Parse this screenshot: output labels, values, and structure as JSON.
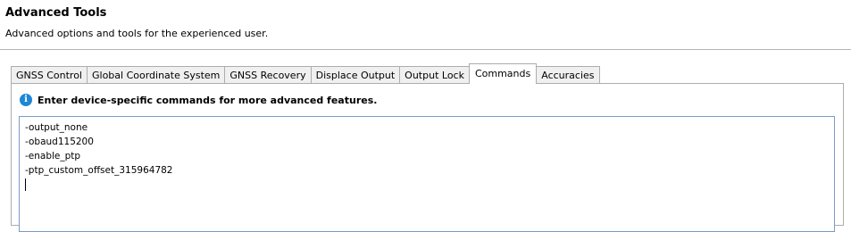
{
  "header": {
    "title": "Advanced Tools",
    "subtitle": "Advanced options and tools for the experienced user."
  },
  "tabs": [
    {
      "label": "GNSS Control",
      "active": false
    },
    {
      "label": "Global Coordinate System",
      "active": false
    },
    {
      "label": "GNSS Recovery",
      "active": false
    },
    {
      "label": "Displace Output",
      "active": false
    },
    {
      "label": "Output Lock",
      "active": false
    },
    {
      "label": "Commands",
      "active": true
    },
    {
      "label": "Accuracies",
      "active": false
    }
  ],
  "commands_panel": {
    "info_icon": "info-icon",
    "info_text": "Enter device-specific commands for more advanced features.",
    "command_lines": [
      "-output_none",
      "-obaud115200",
      "-enable_ptp",
      "-ptp_custom_offset_315964782"
    ]
  },
  "colors": {
    "info_icon": "#1e87d6",
    "border": "#adadad",
    "input_border": "#7a9cc6"
  }
}
